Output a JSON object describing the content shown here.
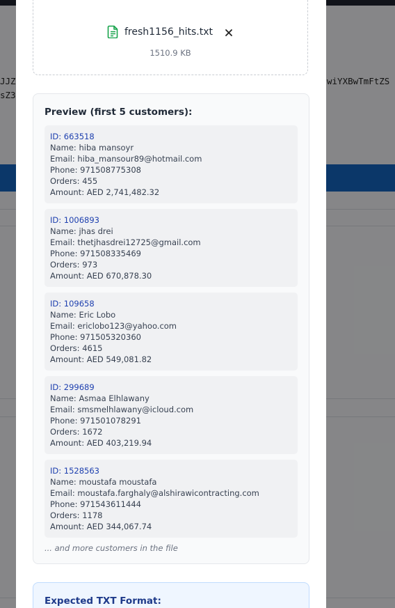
{
  "background": {
    "code_lines": [
      "JJZ",
      "sZ3",
      "wiYXBwTmFtZS"
    ]
  },
  "file": {
    "name": "fresh1156_hits.txt",
    "size": "1510.9 KB"
  },
  "preview": {
    "title": "Preview (first 5 customers):",
    "customers": [
      {
        "id": "ID: 663518",
        "name": "Name: hiba mansoyr",
        "email": "Email: hiba_mansour89@hotmail.com",
        "phone": "Phone: 971508775308",
        "orders": "Orders: 455",
        "amount": "Amount: AED 2,741,482.32"
      },
      {
        "id": "ID: 1006893",
        "name": "Name: jhas drei",
        "email": "Email: thetjhasdrei12725@gmail.com",
        "phone": "Phone: 971508335469",
        "orders": "Orders: 973",
        "amount": "Amount: AED 670,878.30"
      },
      {
        "id": "ID: 109658",
        "name": "Name: Eric Lobo",
        "email": "Email: ericlobo123@yahoo.com",
        "phone": "Phone: 971505320360",
        "orders": "Orders: 4615",
        "amount": "Amount: AED 549,081.82"
      },
      {
        "id": "ID: 299689",
        "name": "Name: Asmaa Elhlawany",
        "email": "Email: smsmelhlawany@icloud.com",
        "phone": "Phone: 971501078291",
        "orders": "Orders: 1672",
        "amount": "Amount: AED 403,219.94"
      },
      {
        "id": "ID: 1528563",
        "name": "Name: moustafa moustafa",
        "email": "Email: moustafa.farghaly@alshirawicontracting.com",
        "phone": "Phone: 971543611444",
        "orders": "Orders: 1178",
        "amount": "Amount: AED 344,067.74"
      }
    ],
    "more_note": "... and more customers in the file"
  },
  "format": {
    "title": "Expected TXT Format:"
  },
  "colors": {
    "accent_blue": "#1565c0",
    "file_icon_green": "#16a34a",
    "id_blue": "#1e40af"
  },
  "icons": {
    "file": "file-text-icon",
    "close": "close-icon"
  }
}
